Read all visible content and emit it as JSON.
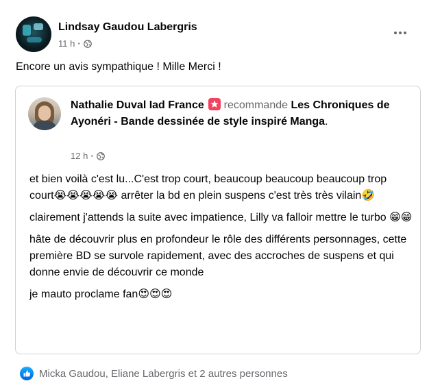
{
  "post": {
    "author": "Lindsay Gaudou Labergris",
    "time": "11 h",
    "separator": "·",
    "text": "Encore un avis sympathique ! Mille Merci !"
  },
  "shared_review": {
    "reviewer": "Nathalie Duval Iad France",
    "action": "recommande",
    "page_title": "Les Chroniques de Ayonéri - Bande dessinée de style inspiré Manga",
    "page_title_end": ".",
    "time": "12 h",
    "separator": "·",
    "paragraphs": [
      {
        "text": "et bien voilà c'est lu...C'est trop court, beaucoup beaucoup beaucoup trop court",
        "emoji_after": "😭😭😭😭😭",
        "text2": " arrêter la bd en plein suspens c'est très très vilain",
        "emoji_end": "🤣"
      },
      {
        "text": "clairement j'attends la suite avec impatience, Lilly va falloir mettre le turbo ",
        "emoji_after": "😁😁"
      },
      {
        "text": "hâte de découvrir plus en profondeur le rôle des différents personnages, cette première BD se survole rapidement, avec des accroches de suspens et qui donne envie de découvrir ce monde"
      },
      {
        "text": "je mauto proclame fan",
        "emoji_after": "😍😍😍"
      }
    ]
  },
  "reactions": {
    "summary": "Micka Gaudou, Eliane Labergris et 2 autres personnes"
  },
  "icons": {
    "like": "like-icon",
    "globe": "globe-icon",
    "recommend": "recommend-icon",
    "more": "more-icon"
  },
  "colors": {
    "accent_blue": "#1877f2",
    "recommend_red": "#f3425f",
    "secondary_text": "#65676b",
    "border": "#ced0d4"
  }
}
